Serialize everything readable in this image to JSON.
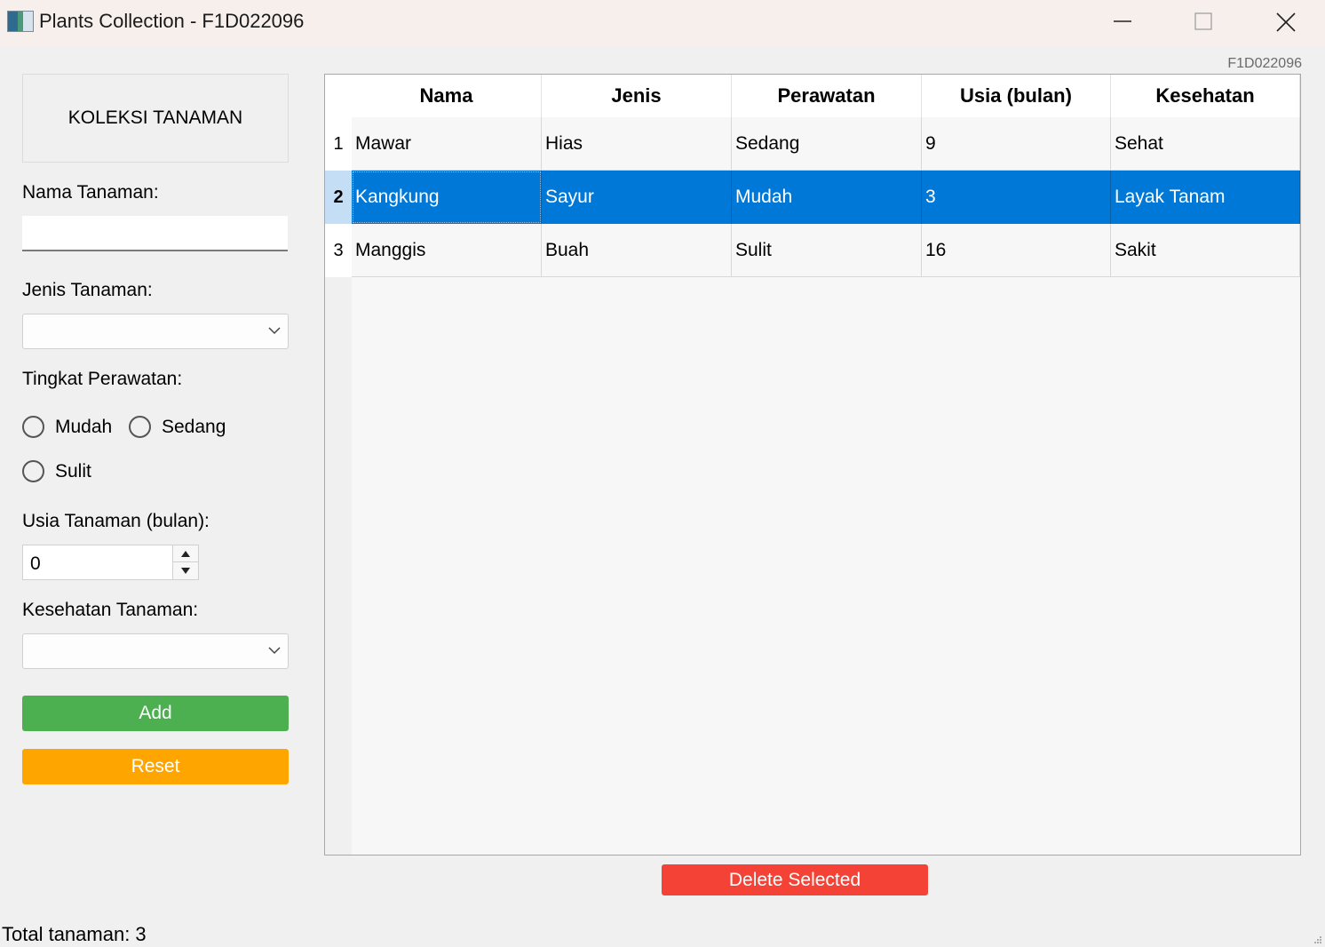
{
  "window": {
    "title": "Plants Collection - F1D022096",
    "corner_id": "F1D022096"
  },
  "form": {
    "header": "KOLEKSI TANAMAN",
    "nama_label": "Nama Tanaman:",
    "nama_value": "",
    "jenis_label": "Jenis Tanaman:",
    "jenis_selected": "",
    "perawatan_label": "Tingkat Perawatan:",
    "perawatan_options": [
      "Mudah",
      "Sedang",
      "Sulit"
    ],
    "usia_label": "Usia Tanaman (bulan):",
    "usia_value": "0",
    "kesehatan_label": "Kesehatan Tanaman:",
    "kesehatan_selected": "",
    "add_label": "Add",
    "reset_label": "Reset"
  },
  "table": {
    "columns": [
      "Nama",
      "Jenis",
      "Perawatan",
      "Usia (bulan)",
      "Kesehatan"
    ],
    "rows": [
      {
        "num": "1",
        "cells": [
          "Mawar",
          "Hias",
          "Sedang",
          "9",
          "Sehat"
        ]
      },
      {
        "num": "2",
        "cells": [
          "Kangkung",
          "Sayur",
          "Mudah",
          "3",
          "Layak Tanam"
        ]
      },
      {
        "num": "3",
        "cells": [
          "Manggis",
          "Buah",
          "Sulit",
          "16",
          "Sakit"
        ]
      }
    ],
    "selected_row": 2
  },
  "delete_label": "Delete Selected",
  "status_text": "Total tanaman: 3",
  "colors": {
    "add": "#4caf50",
    "reset": "#ffa500",
    "delete": "#f44336",
    "selection": "#0078d7"
  }
}
